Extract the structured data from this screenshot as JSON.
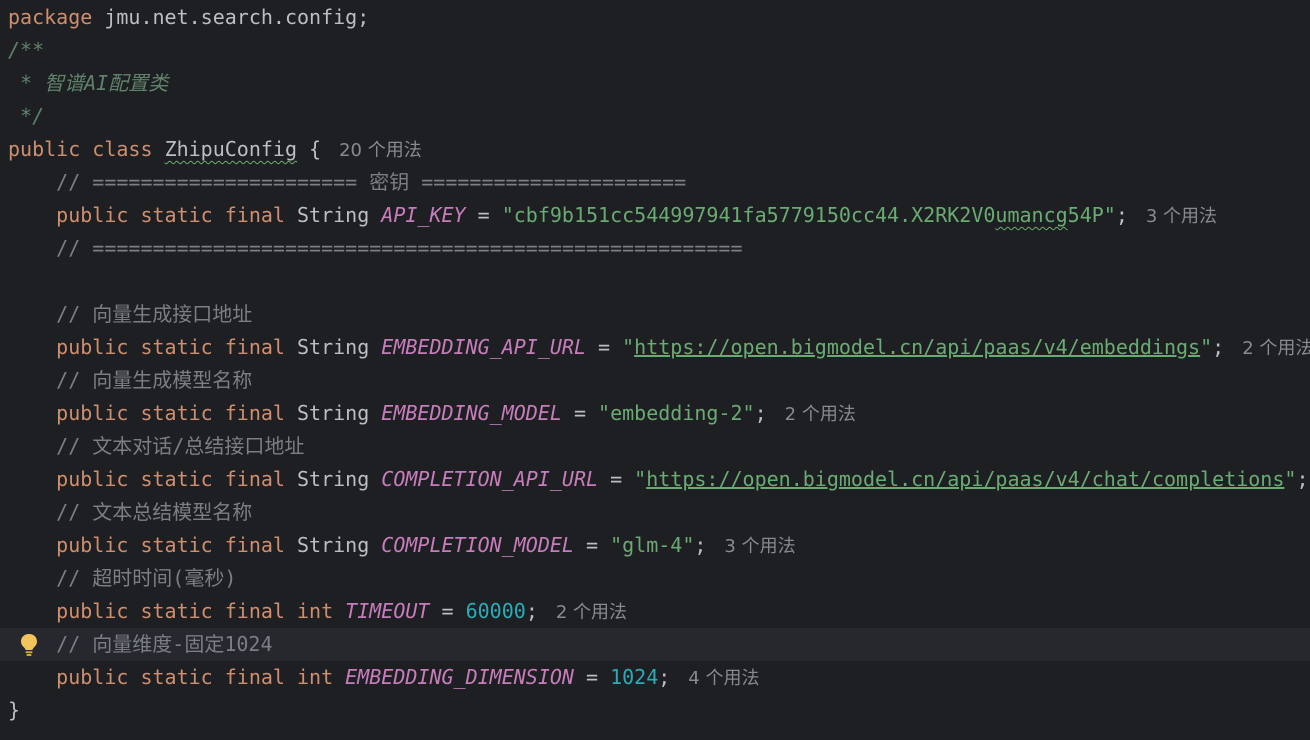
{
  "lines": {
    "l1": {
      "kw": "package",
      "text": " jmu.net.search.config;"
    },
    "l2": {
      "text": "/**"
    },
    "l3": {
      "text": " * 智谱AI配置类"
    },
    "l4": {
      "text": " */"
    },
    "l5": {
      "kw1": "public",
      "kw2": "class",
      "name": "ZhipuConfig",
      "brace": " {",
      "hint": "20 个用法"
    },
    "l6": {
      "text": "    // ====================== 密钥 ======================"
    },
    "l7": {
      "mods": "public static final",
      "type": "String",
      "name": "API_KEY",
      "eq": " = ",
      "value_pre": "\"cbf9b151cc544997941fa5779150cc44.X2RK2V0",
      "value_sq": "umancg",
      "value_post": "54P\"",
      "semi": ";",
      "hint": "3 个用法"
    },
    "l8": {
      "text": "    // ======================================================"
    },
    "l10": {
      "text": "    // 向量生成接口地址"
    },
    "l11": {
      "mods": "public static final",
      "type": "String",
      "name": "EMBEDDING_API_URL",
      "eq": " = ",
      "value": "https://open.bigmodel.cn/api/paas/v4/embeddings",
      "semi": ";",
      "hint": "2 个用法"
    },
    "l12": {
      "text": "    // 向量生成模型名称"
    },
    "l13": {
      "mods": "public static final",
      "type": "String",
      "name": "EMBEDDING_MODEL",
      "eq": " = ",
      "value": "\"embedding-2\"",
      "semi": ";",
      "hint": "2 个用法"
    },
    "l14": {
      "text": "    // 文本对话/总结接口地址"
    },
    "l15": {
      "mods": "public static final",
      "type": "String",
      "name": "COMPLETION_API_URL",
      "eq": " = ",
      "value": "https://open.bigmodel.cn/api/paas/v4/chat/completions",
      "semi": ";"
    },
    "l16": {
      "text": "    // 文本总结模型名称"
    },
    "l17": {
      "mods": "public static final",
      "type": "String",
      "name": "COMPLETION_MODEL",
      "eq": " = ",
      "value": "\"glm-4\"",
      "semi": ";",
      "hint": "3 个用法"
    },
    "l18": {
      "text": "    // 超时时间(毫秒)"
    },
    "l19": {
      "mods": "public static final",
      "type": "int",
      "name": "TIMEOUT",
      "eq": " = ",
      "value": "60000",
      "semi": ";",
      "hint": "2 个用法"
    },
    "l20": {
      "text": "    // 向量维度-固定1024"
    },
    "l21": {
      "mods": "public static final",
      "type": "int",
      "name": "EMBEDDING_DIMENSION",
      "eq": " = ",
      "value": "1024",
      "semi": ";",
      "hint": "4 个用法"
    },
    "l22": {
      "text": "}"
    }
  },
  "icons": {
    "intention_bulb": "lightbulb-icon"
  },
  "colors": {
    "background": "#1e1f22",
    "caret_line": "#26282e",
    "keyword": "#cf8e6d",
    "constant": "#c77dbb",
    "string": "#6aab73",
    "number": "#2aacb8",
    "comment": "#7a7e85",
    "doc_comment": "#5f826b",
    "inlay_hint": "#868a91",
    "bulb": "#f2c55c"
  }
}
